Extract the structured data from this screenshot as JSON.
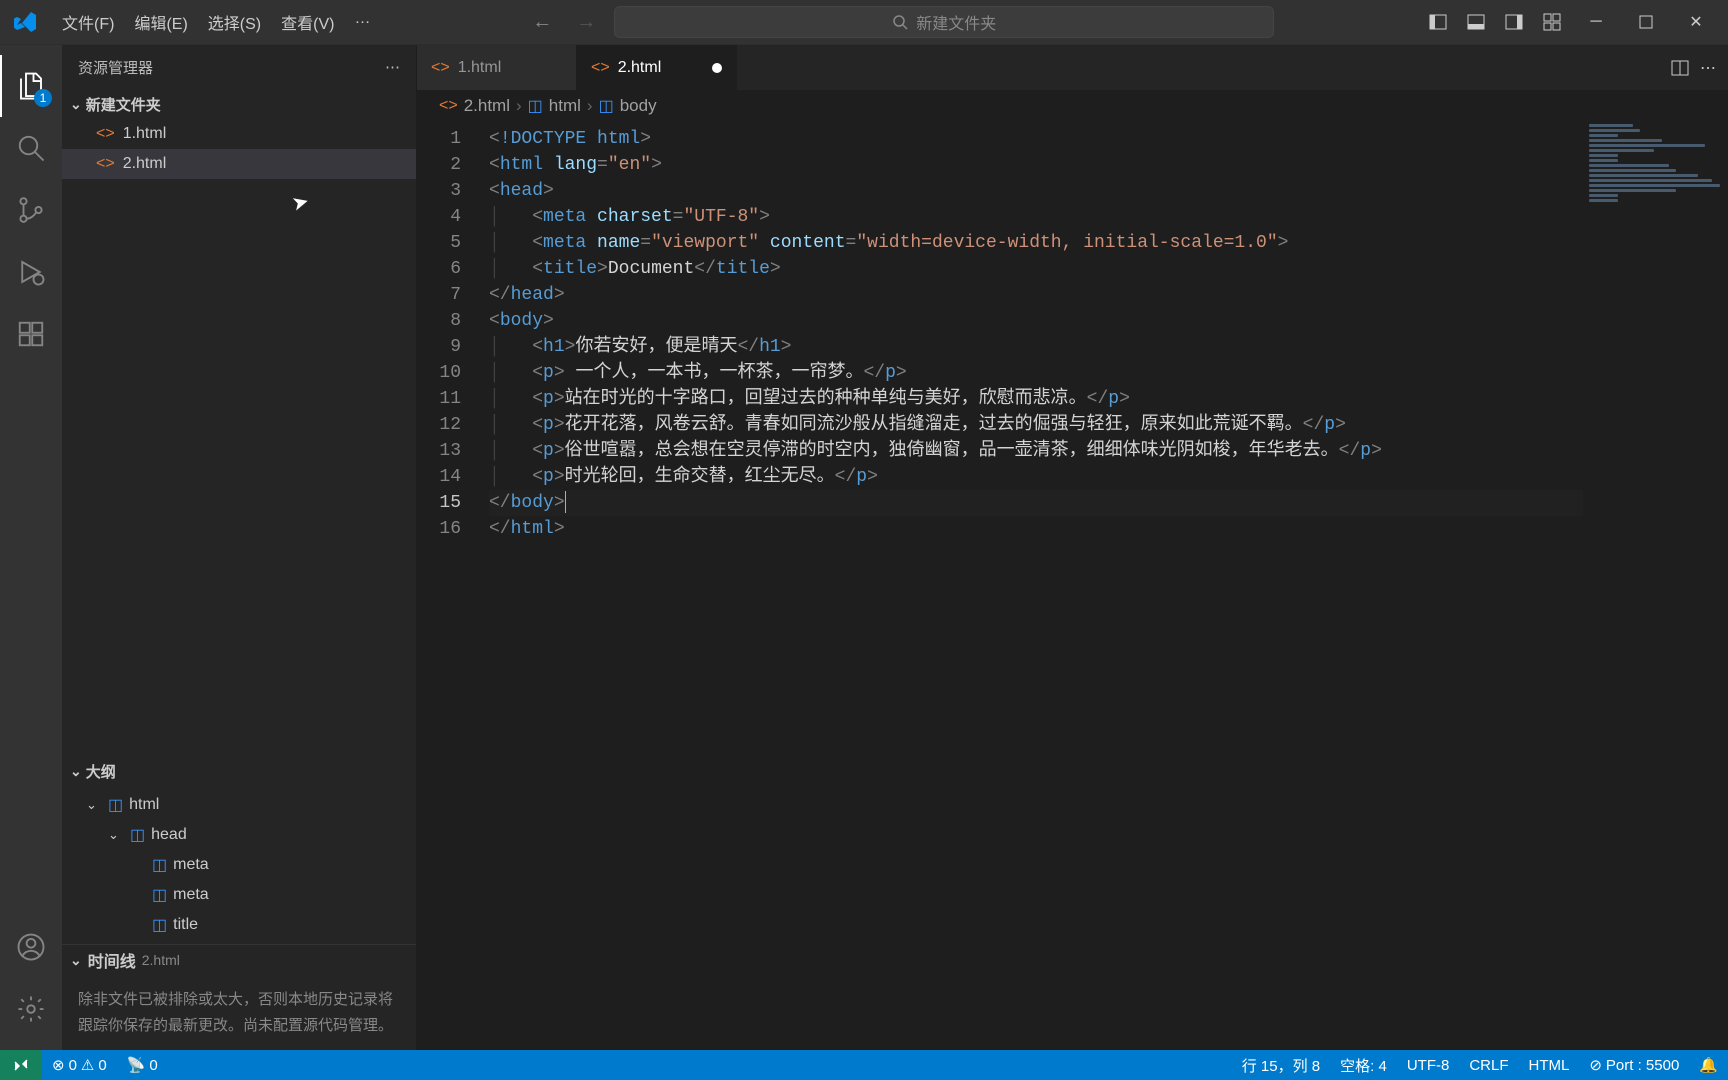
{
  "menubar": {
    "items": [
      "文件(F)",
      "编辑(E)",
      "选择(S)",
      "查看(V)",
      "…"
    ]
  },
  "search": {
    "placeholder": "新建文件夹"
  },
  "activitybar": {
    "badge": "1"
  },
  "sidebar": {
    "title": "资源管理器",
    "folder": "新建文件夹",
    "files": [
      {
        "name": "1.html"
      },
      {
        "name": "2.html"
      }
    ],
    "outline": {
      "title": "大纲",
      "items": [
        {
          "label": "html",
          "indent": 0
        },
        {
          "label": "head",
          "indent": 1
        },
        {
          "label": "meta",
          "indent": 2
        },
        {
          "label": "meta",
          "indent": 2
        },
        {
          "label": "title",
          "indent": 2
        }
      ]
    },
    "timeline": {
      "title": "时间线",
      "file": "2.html",
      "text": "除非文件已被排除或太大，否则本地历史记录将跟踪你保存的最新更改。尚未配置源代码管理。"
    }
  },
  "tabs": [
    {
      "name": "1.html",
      "active": false
    },
    {
      "name": "2.html",
      "active": true,
      "dirty": true
    }
  ],
  "breadcrumbs": {
    "file": "2.html",
    "path": [
      "html",
      "body"
    ]
  },
  "code": {
    "lines": [
      {
        "n": 1,
        "i": 0,
        "tokens": [
          [
            "br",
            "<"
          ],
          [
            "doc",
            "!DOCTYPE "
          ],
          [
            "tag",
            "html"
          ],
          [
            "br",
            ">"
          ]
        ]
      },
      {
        "n": 2,
        "i": 0,
        "tokens": [
          [
            "br",
            "<"
          ],
          [
            "tag",
            "html "
          ],
          [
            "attr",
            "lang"
          ],
          [
            "br",
            "="
          ],
          [
            "str",
            "\"en\""
          ],
          [
            "br",
            ">"
          ]
        ]
      },
      {
        "n": 3,
        "i": 0,
        "tokens": [
          [
            "br",
            "<"
          ],
          [
            "tag",
            "head"
          ],
          [
            "br",
            ">"
          ]
        ]
      },
      {
        "n": 4,
        "i": 1,
        "tokens": [
          [
            "br",
            "<"
          ],
          [
            "tag",
            "meta "
          ],
          [
            "attr",
            "charset"
          ],
          [
            "br",
            "="
          ],
          [
            "str",
            "\"UTF-8\""
          ],
          [
            "br",
            ">"
          ]
        ]
      },
      {
        "n": 5,
        "i": 1,
        "tokens": [
          [
            "br",
            "<"
          ],
          [
            "tag",
            "meta "
          ],
          [
            "attr",
            "name"
          ],
          [
            "br",
            "="
          ],
          [
            "str",
            "\"viewport\""
          ],
          [
            "tag",
            " "
          ],
          [
            "attr",
            "content"
          ],
          [
            "br",
            "="
          ],
          [
            "str",
            "\"width=device-width, initial-scale=1.0\""
          ],
          [
            "br",
            ">"
          ]
        ]
      },
      {
        "n": 6,
        "i": 1,
        "tokens": [
          [
            "br",
            "<"
          ],
          [
            "tag",
            "title"
          ],
          [
            "br",
            ">"
          ],
          [
            "text",
            "Document"
          ],
          [
            "br",
            "</"
          ],
          [
            "tag",
            "title"
          ],
          [
            "br",
            ">"
          ]
        ]
      },
      {
        "n": 7,
        "i": 0,
        "tokens": [
          [
            "br",
            "</"
          ],
          [
            "tag",
            "head"
          ],
          [
            "br",
            ">"
          ]
        ]
      },
      {
        "n": 8,
        "i": 0,
        "tokens": [
          [
            "br",
            "<"
          ],
          [
            "tag",
            "body"
          ],
          [
            "br",
            ">"
          ]
        ]
      },
      {
        "n": 9,
        "i": 1,
        "tokens": [
          [
            "br",
            "<"
          ],
          [
            "tag",
            "h1"
          ],
          [
            "br",
            ">"
          ],
          [
            "text",
            "你若安好，便是晴天"
          ],
          [
            "br",
            "</"
          ],
          [
            "tag",
            "h1"
          ],
          [
            "br",
            ">"
          ]
        ]
      },
      {
        "n": 10,
        "i": 1,
        "tokens": [
          [
            "br",
            "<"
          ],
          [
            "tag",
            "p"
          ],
          [
            "br",
            ">"
          ],
          [
            "text",
            " 一个人，一本书，一杯茶，一帘梦。"
          ],
          [
            "br",
            "</"
          ],
          [
            "tag",
            "p"
          ],
          [
            "br",
            ">"
          ]
        ]
      },
      {
        "n": 11,
        "i": 1,
        "tokens": [
          [
            "br",
            "<"
          ],
          [
            "tag",
            "p"
          ],
          [
            "br",
            ">"
          ],
          [
            "text",
            "站在时光的十字路口，回望过去的种种单纯与美好，欣慰而悲凉。"
          ],
          [
            "br",
            "</"
          ],
          [
            "tag",
            "p"
          ],
          [
            "br",
            ">"
          ]
        ]
      },
      {
        "n": 12,
        "i": 1,
        "tokens": [
          [
            "br",
            "<"
          ],
          [
            "tag",
            "p"
          ],
          [
            "br",
            ">"
          ],
          [
            "text",
            "花开花落，风卷云舒。青春如同流沙般从指缝溜走，过去的倔强与轻狂，原来如此荒诞不羁。"
          ],
          [
            "br",
            "</"
          ],
          [
            "tag",
            "p"
          ],
          [
            "br",
            ">"
          ]
        ]
      },
      {
        "n": 13,
        "i": 1,
        "tokens": [
          [
            "br",
            "<"
          ],
          [
            "tag",
            "p"
          ],
          [
            "br",
            ">"
          ],
          [
            "text",
            "俗世喧嚣，总会想在空灵停滞的时空内，独倚幽窗，品一壶清茶，细细体味光阴如梭，年华老去。"
          ],
          [
            "br",
            "</"
          ],
          [
            "tag",
            "p"
          ],
          [
            "br",
            ">"
          ]
        ]
      },
      {
        "n": 14,
        "i": 1,
        "tokens": [
          [
            "br",
            "<"
          ],
          [
            "tag",
            "p"
          ],
          [
            "br",
            ">"
          ],
          [
            "text",
            "时光轮回，生命交替，红尘无尽。"
          ],
          [
            "br",
            "</"
          ],
          [
            "tag",
            "p"
          ],
          [
            "br",
            ">"
          ]
        ]
      },
      {
        "n": 15,
        "i": 0,
        "tokens": [
          [
            "br",
            "</"
          ],
          [
            "tag",
            "body"
          ],
          [
            "br",
            ">"
          ]
        ],
        "active": true,
        "cursor": true
      },
      {
        "n": 16,
        "i": 0,
        "tokens": [
          [
            "br",
            "</"
          ],
          [
            "tag",
            "html"
          ],
          [
            "br",
            ">"
          ]
        ]
      }
    ]
  },
  "statusbar": {
    "errors": "0",
    "warnings": "0",
    "radio": "0",
    "position": "行 15，列 8",
    "spaces": "空格: 4",
    "encoding": "UTF-8",
    "eol": "CRLF",
    "language": "HTML",
    "port": "Port : 5500"
  }
}
